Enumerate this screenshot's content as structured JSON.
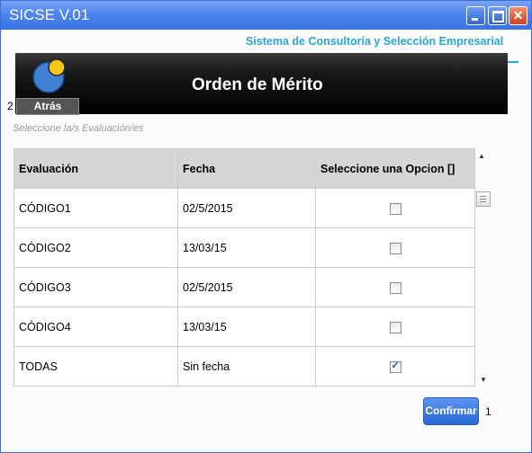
{
  "window": {
    "title": "SICSE V.01"
  },
  "header": {
    "subtitle": "Sistema de Consultoría y Selección Empresarial",
    "banner_title": "Orden de Mérito",
    "back_label": "Atrás",
    "step_number": "2"
  },
  "hint": "Seleccione  la/s Evaluación/es",
  "table": {
    "columns": [
      "Evaluación",
      "Fecha",
      "Seleccione una Opcion []"
    ],
    "rows": [
      {
        "evaluacion": "CÓDIGO1",
        "fecha": "02/5/2015",
        "checked": false
      },
      {
        "evaluacion": "CÓDIGO2",
        "fecha": "13/03/15",
        "checked": false
      },
      {
        "evaluacion": "CÓDIGO3",
        "fecha": "02/5/2015",
        "checked": false
      },
      {
        "evaluacion": "CÓDIGO4",
        "fecha": "13/03/15",
        "checked": false
      },
      {
        "evaluacion": "TODAS",
        "fecha": "Sin fecha",
        "checked": true
      }
    ]
  },
  "footer": {
    "confirm_label": "Confirmar",
    "step_number": "1"
  },
  "colors": {
    "titlebar": "#4e84ee",
    "accent": "#2aa7d6",
    "confirm": "#2865d6",
    "logo_blue": "#3f7fd4",
    "logo_yellow": "#f5c518"
  }
}
